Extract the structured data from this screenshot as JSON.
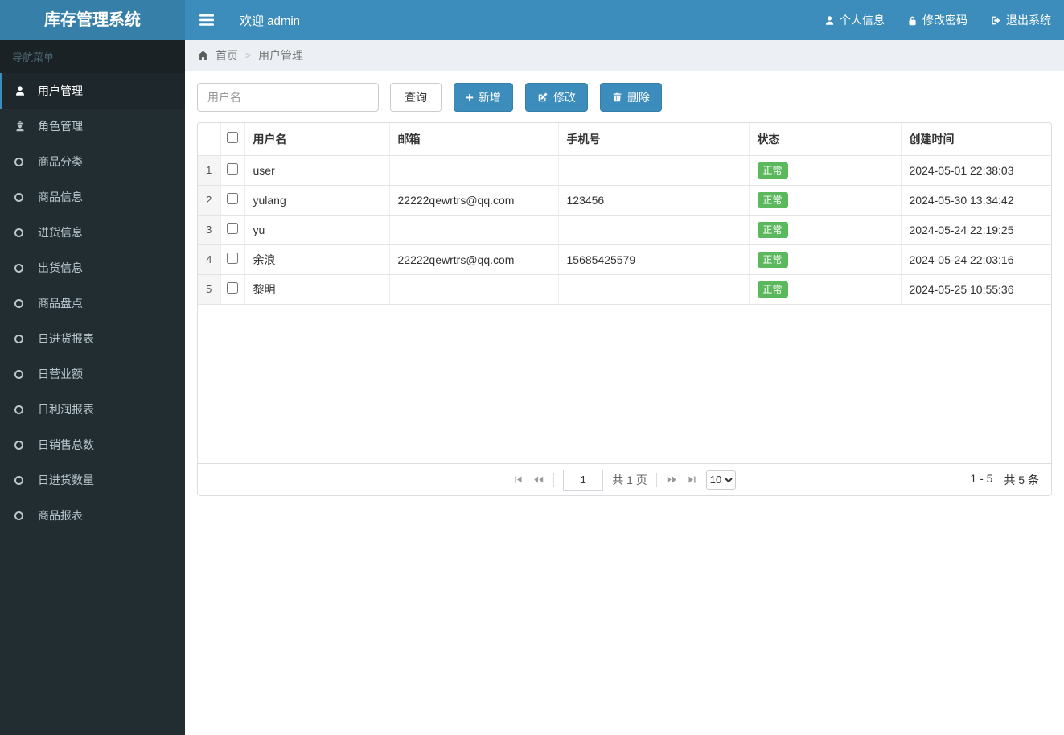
{
  "app": {
    "title": "库存管理系统"
  },
  "colors": {
    "navbar": "#3c8dbc",
    "logo_bg": "#367fa9",
    "sidebar_bg": "#222d32",
    "active_item_bg": "#1e282c",
    "accent": "#3c8dbc",
    "status_badge": "#5cb85c"
  },
  "navbar": {
    "hamburger_icon": "hamburger-icon",
    "welcome": "欢迎 admin",
    "links": [
      {
        "label": "个人信息",
        "icon": "user-icon"
      },
      {
        "label": "修改密码",
        "icon": "lock-icon"
      },
      {
        "label": "退出系统",
        "icon": "sign-out-icon"
      }
    ]
  },
  "sidebar": {
    "header": "导航菜单",
    "items": [
      {
        "label": "用户管理",
        "icon": "user-icon",
        "active": true
      },
      {
        "label": "角色管理",
        "icon": "user-secret-icon",
        "active": false
      },
      {
        "label": "商品分类",
        "icon": "circle-icon",
        "active": false
      },
      {
        "label": "商品信息",
        "icon": "circle-icon",
        "active": false
      },
      {
        "label": "进货信息",
        "icon": "circle-icon",
        "active": false
      },
      {
        "label": "出货信息",
        "icon": "circle-icon",
        "active": false
      },
      {
        "label": "商品盘点",
        "icon": "circle-icon",
        "active": false
      },
      {
        "label": "日进货报表",
        "icon": "circle-icon",
        "active": false
      },
      {
        "label": "日营业额",
        "icon": "circle-icon",
        "active": false
      },
      {
        "label": "日利润报表",
        "icon": "circle-icon",
        "active": false
      },
      {
        "label": "日销售总数",
        "icon": "circle-icon",
        "active": false
      },
      {
        "label": "日进货数量",
        "icon": "circle-icon",
        "active": false
      },
      {
        "label": "商品报表",
        "icon": "circle-icon",
        "active": false
      }
    ]
  },
  "breadcrumb": {
    "home_icon": "home-icon",
    "home": "首页",
    "separator": ">",
    "current": "用户管理"
  },
  "toolbar": {
    "search_placeholder": "用户名",
    "search_button": "查询",
    "add_button": "新增",
    "edit_button": "修改",
    "delete_button": "删除"
  },
  "table": {
    "columns": [
      "用户名",
      "邮箱",
      "手机号",
      "状态",
      "创建时间"
    ],
    "rows": [
      {
        "index": "1",
        "username": "user",
        "email": "",
        "phone": "",
        "status": "正常",
        "created": "2024-05-01 22:38:03"
      },
      {
        "index": "2",
        "username": "yulang",
        "email": "22222qewrtrs@qq.com",
        "phone": "123456",
        "status": "正常",
        "created": "2024-05-30 13:34:42"
      },
      {
        "index": "3",
        "username": "yu",
        "email": "",
        "phone": "",
        "status": "正常",
        "created": "2024-05-24 22:19:25"
      },
      {
        "index": "4",
        "username": "余浪",
        "email": "22222qewrtrs@qq.com",
        "phone": "15685425579",
        "status": "正常",
        "created": "2024-05-24 22:03:16"
      },
      {
        "index": "5",
        "username": "黎明",
        "email": "",
        "phone": "",
        "status": "正常",
        "created": "2024-05-25 10:55:36"
      }
    ]
  },
  "pagination": {
    "page_value": "1",
    "total_pages_label": "共 1 页",
    "page_size": "10",
    "range_label": "1 - 5",
    "total_label": "共 5 条"
  }
}
